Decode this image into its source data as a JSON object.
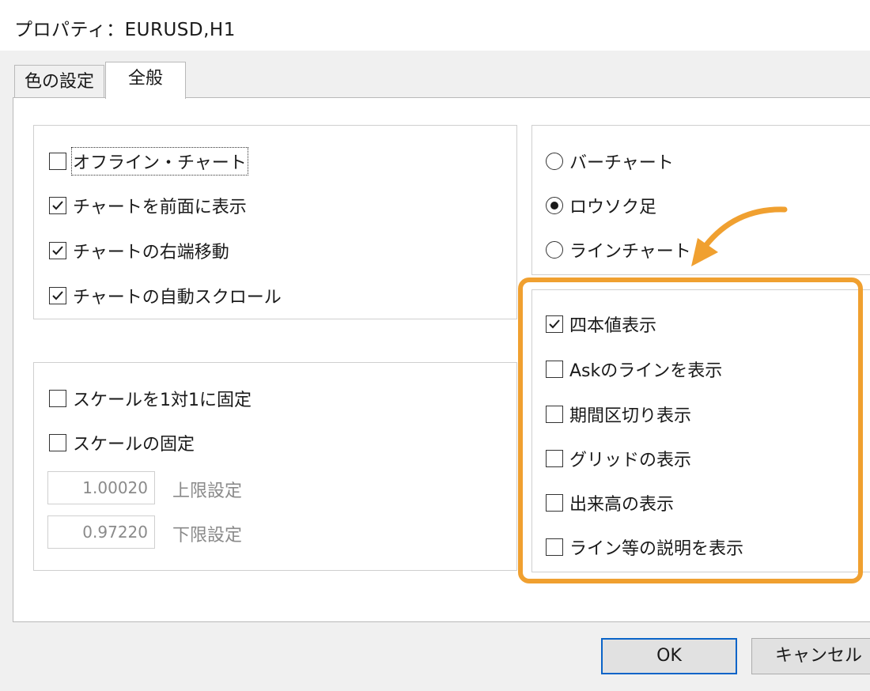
{
  "window": {
    "title": "プロパティ：EURUSD,H1"
  },
  "tabs": [
    {
      "label": "色の設定",
      "active": false
    },
    {
      "label": "全般",
      "active": true
    }
  ],
  "chart_options": [
    {
      "label": "オフライン・チャート",
      "checked": false
    },
    {
      "label": "チャートを前面に表示",
      "checked": true
    },
    {
      "label": "チャートの右端移動",
      "checked": true
    },
    {
      "label": "チャートの自動スクロール",
      "checked": true
    }
  ],
  "scale_options": [
    {
      "label": "スケールを1対1に固定",
      "checked": false
    },
    {
      "label": "スケールの固定",
      "checked": false
    }
  ],
  "scale_limits": {
    "upper_value": "1.00020",
    "upper_label": "上限設定",
    "lower_value": "0.97220",
    "lower_label": "下限設定"
  },
  "chart_types": [
    {
      "label": "バーチャート",
      "selected": false
    },
    {
      "label": "ロウソク足",
      "selected": true
    },
    {
      "label": "ラインチャート",
      "selected": false
    }
  ],
  "display_options": [
    {
      "label": "四本値表示",
      "checked": true
    },
    {
      "label": "Askのラインを表示",
      "checked": false
    },
    {
      "label": "期間区切り表示",
      "checked": false
    },
    {
      "label": "グリッドの表示",
      "checked": false
    },
    {
      "label": "出来高の表示",
      "checked": false
    },
    {
      "label": "ライン等の説明を表示",
      "checked": false
    }
  ],
  "buttons": {
    "ok": "OK",
    "cancel": "キャンセル"
  },
  "colors": {
    "highlight": "#f0a030",
    "default_button_border": "#0a64c8"
  }
}
